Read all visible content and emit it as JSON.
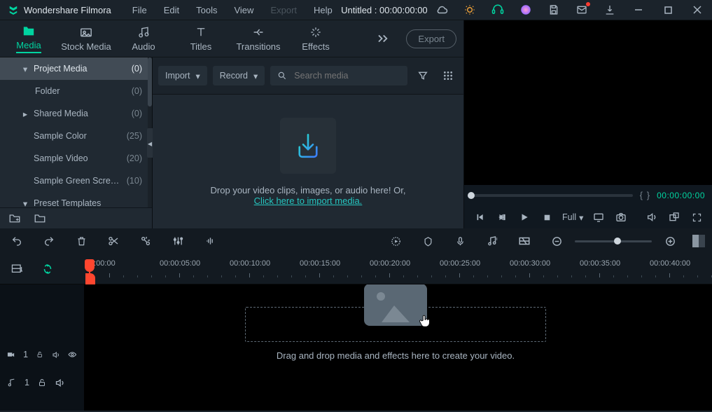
{
  "titlebar": {
    "app_name": "Wondershare Filmora",
    "menus": [
      "File",
      "Edit",
      "Tools",
      "View",
      "Export",
      "Help"
    ],
    "disabled_menu_index": 4,
    "doc_title": "Untitled : 00:00:00:00"
  },
  "module_tabs": {
    "items": [
      {
        "label": "Media"
      },
      {
        "label": "Stock Media"
      },
      {
        "label": "Audio"
      },
      {
        "label": "Titles"
      },
      {
        "label": "Transitions"
      },
      {
        "label": "Effects"
      }
    ],
    "active_index": 0,
    "export_label": "Export"
  },
  "tree": {
    "items": [
      {
        "label": "Project Media",
        "count": "(0)",
        "level": 1,
        "expand": "down",
        "selected": true
      },
      {
        "label": "Folder",
        "count": "(0)",
        "level": 2,
        "expand": "none"
      },
      {
        "label": "Shared Media",
        "count": "(0)",
        "level": 1,
        "expand": "right"
      },
      {
        "label": "Sample Color",
        "count": "(25)",
        "level": 1,
        "expand": "none"
      },
      {
        "label": "Sample Video",
        "count": "(20)",
        "level": 1,
        "expand": "none"
      },
      {
        "label": "Sample Green Scre…",
        "count": "(10)",
        "level": 1,
        "expand": "none"
      },
      {
        "label": "Preset Templates",
        "count": "",
        "level": 1,
        "expand": "down"
      }
    ]
  },
  "media_bar": {
    "import_label": "Import",
    "record_label": "Record",
    "search_placeholder": "Search media"
  },
  "drop": {
    "line1": "Drop your video clips, images, or audio here! Or,",
    "link": "Click here to import media."
  },
  "preview": {
    "timecode": "00:00:00:00",
    "quality": "Full"
  },
  "ruler": {
    "ticks": [
      "0:00:00",
      "00:00:05:00",
      "00:00:10:00",
      "00:00:15:00",
      "00:00:20:00",
      "00:00:25:00",
      "00:00:30:00",
      "00:00:35:00",
      "00:00:40:00"
    ]
  },
  "tracks": {
    "video_label": "1",
    "audio_label": "1"
  },
  "timeline": {
    "drop_text": "Drag and drop media and effects here to create your video."
  }
}
